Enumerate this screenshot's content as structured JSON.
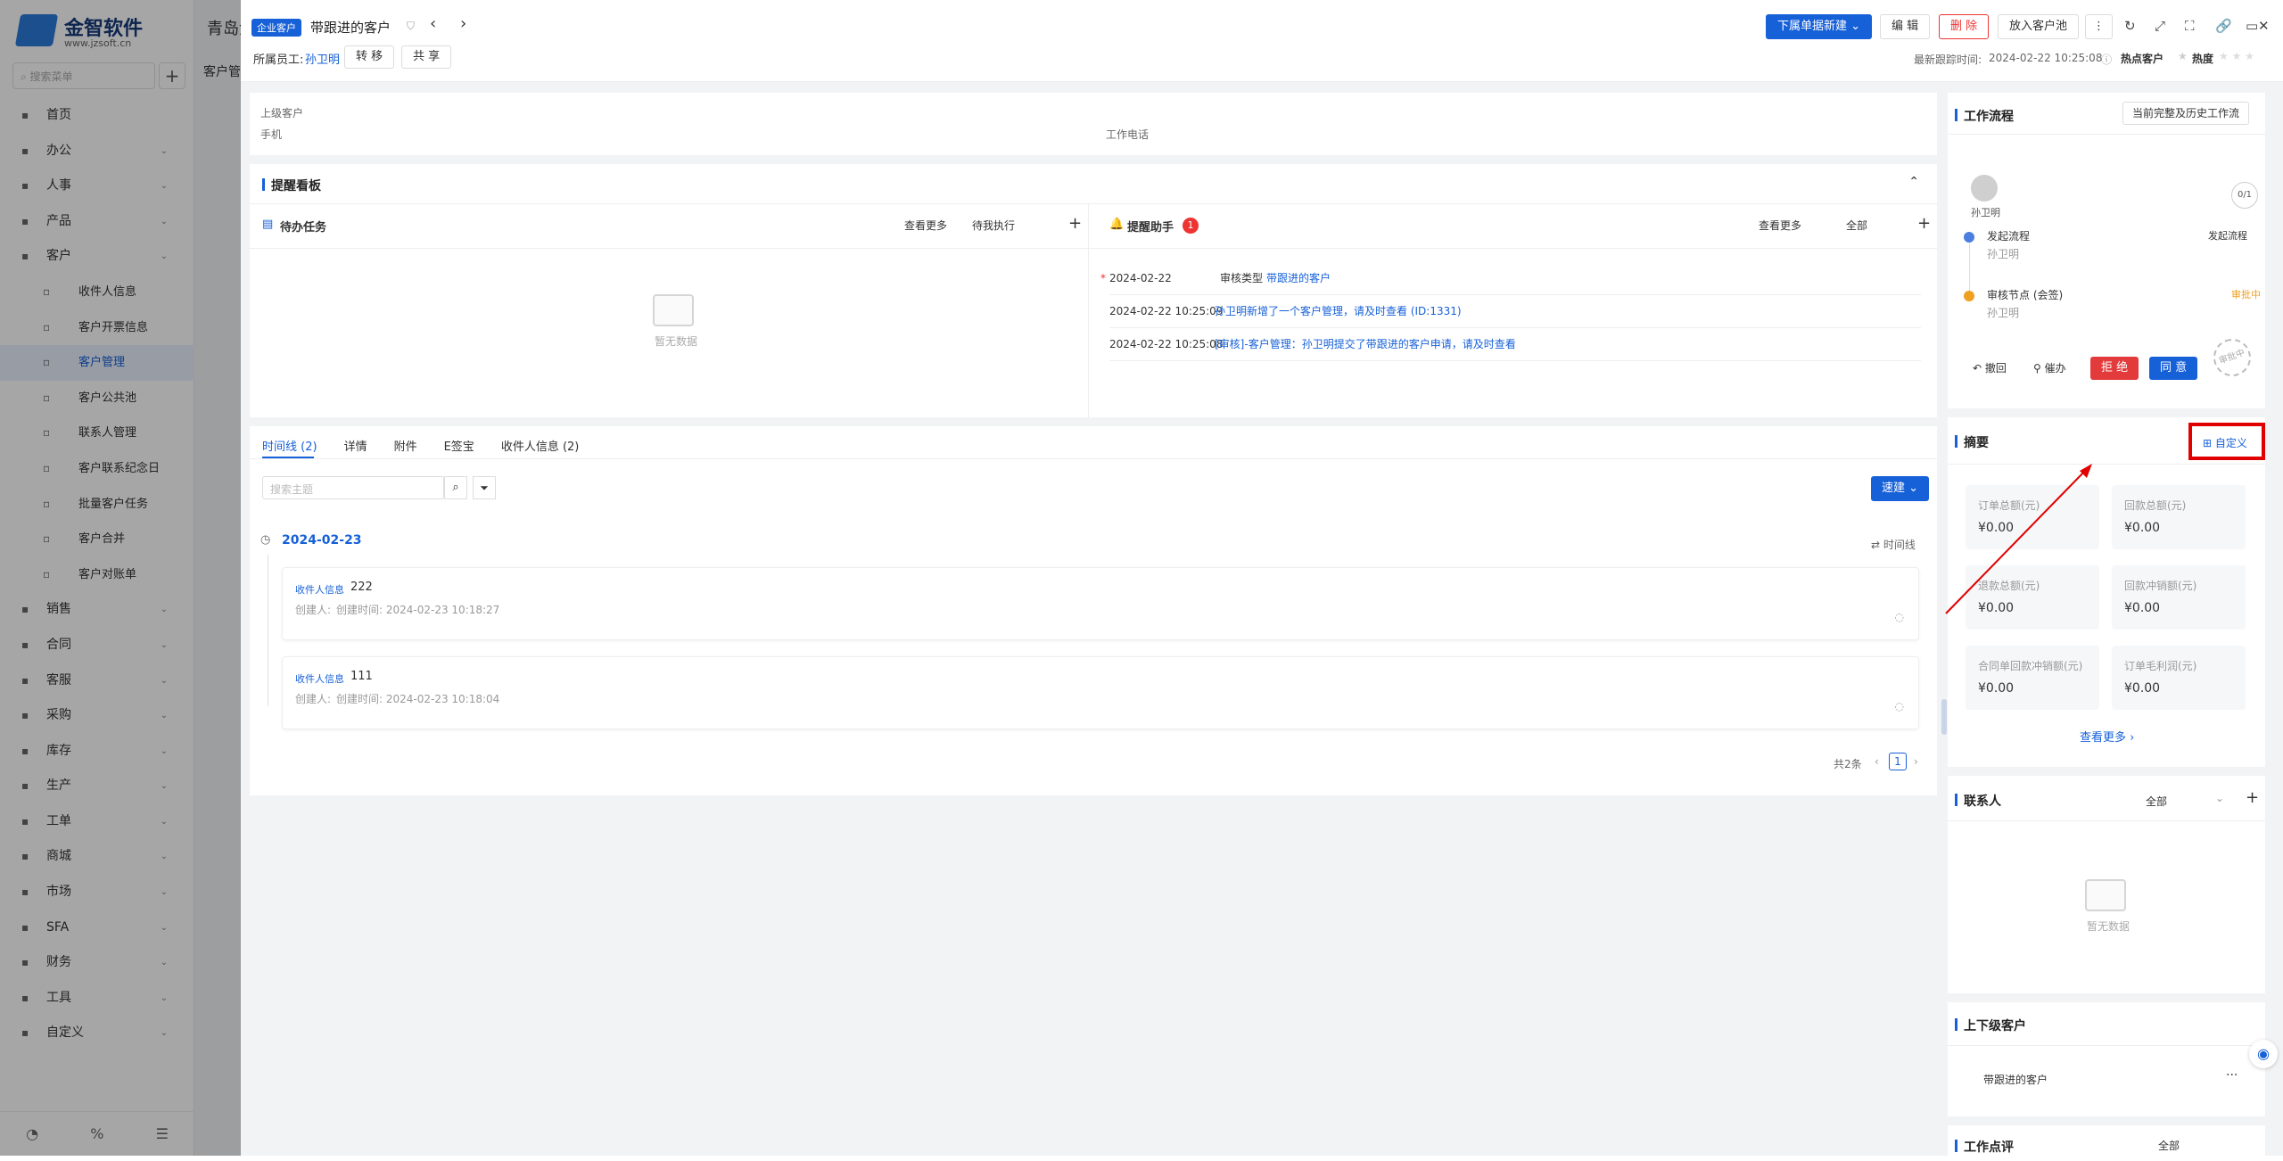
{
  "background_app": {
    "logo_name": "金智软件",
    "logo_url": "www.jzsoft.cn",
    "title": "青岛金",
    "sidebar_search_placeholder": "搜索菜单",
    "section_label": "客户管",
    "nav": [
      {
        "label": "首页",
        "chevron": false,
        "sub": false
      },
      {
        "label": "办公",
        "chevron": true,
        "sub": false
      },
      {
        "label": "人事",
        "chevron": true,
        "sub": false
      },
      {
        "label": "产品",
        "chevron": true,
        "sub": false
      },
      {
        "label": "客户",
        "chevron": true,
        "sub": false
      },
      {
        "label": "收件人信息",
        "chevron": false,
        "sub": true
      },
      {
        "label": "客户开票信息",
        "chevron": false,
        "sub": true
      },
      {
        "label": "客户管理",
        "chevron": false,
        "sub": true,
        "active": true
      },
      {
        "label": "客户公共池",
        "chevron": false,
        "sub": true
      },
      {
        "label": "联系人管理",
        "chevron": false,
        "sub": true
      },
      {
        "label": "客户联系纪念日",
        "chevron": false,
        "sub": true
      },
      {
        "label": "批量客户任务",
        "chevron": false,
        "sub": true
      },
      {
        "label": "客户合并",
        "chevron": false,
        "sub": true
      },
      {
        "label": "客户对账单",
        "chevron": false,
        "sub": true
      },
      {
        "label": "销售",
        "chevron": true,
        "sub": false
      },
      {
        "label": "合同",
        "chevron": true,
        "sub": false
      },
      {
        "label": "客服",
        "chevron": true,
        "sub": false
      },
      {
        "label": "采购",
        "chevron": true,
        "sub": false
      },
      {
        "label": "库存",
        "chevron": true,
        "sub": false
      },
      {
        "label": "生产",
        "chevron": true,
        "sub": false
      },
      {
        "label": "工单",
        "chevron": true,
        "sub": false
      },
      {
        "label": "商城",
        "chevron": true,
        "sub": false
      },
      {
        "label": "市场",
        "chevron": true,
        "sub": false
      },
      {
        "label": "SFA",
        "chevron": true,
        "sub": false
      },
      {
        "label": "财务",
        "chevron": true,
        "sub": false
      },
      {
        "label": "工具",
        "chevron": true,
        "sub": false
      },
      {
        "label": "自定义",
        "chevron": true,
        "sub": false
      }
    ]
  },
  "header": {
    "tag": "企业客户",
    "title": "带跟进的客户",
    "owner_label": "所属员工:",
    "owner_name": "孙卫明",
    "transfer": "转 移",
    "share": "共 享",
    "new_btn": "下属单据新建",
    "edit_btn": "编 辑",
    "delete_btn": "删 除",
    "pool_btn": "放入客户池",
    "last_follow": "最新跟踪时间:",
    "last_follow_time": "2024-02-22 10:25:08",
    "hot_label": "热点客户",
    "heat_label": "热度"
  },
  "info": {
    "parent": "上级客户",
    "phone": "手机",
    "work_phone": "工作电话"
  },
  "reminder": {
    "title": "提醒看板",
    "todo_title": "待办任务",
    "todo_more": "查看更多",
    "todo_filter": "待我执行",
    "empty": "暂无数据",
    "assistant_title": "提醒助手",
    "assistant_badge": "1",
    "assistant_more": "查看更多",
    "assistant_filter": "全部",
    "items": [
      {
        "time": "2024-02-22",
        "prefix": "审核类型",
        "text": "带跟进的客户"
      },
      {
        "time": "2024-02-22 10:25:09",
        "prefix": "",
        "text": "孙卫明新增了一个客户管理，请及时查看 (ID:1331)"
      },
      {
        "time": "2024-02-22 10:25:08",
        "prefix": "",
        "text": "[审核]-客户管理：孙卫明提交了带跟进的客户申请，请及时查看"
      }
    ]
  },
  "timeline": {
    "tabs": [
      "时间线 (2)",
      "详情",
      "附件",
      "E签宝",
      "收件人信息 (2)"
    ],
    "search_placeholder": "搜索主题",
    "quick_new": "速建",
    "date": "2024-02-23",
    "view_label": "时间线",
    "entries": [
      {
        "type": "收件人信息",
        "value": "222",
        "creator": "创建人:",
        "created": "创建时间: 2024-02-23 10:18:27"
      },
      {
        "type": "收件人信息",
        "value": "111",
        "creator": "创建人:",
        "created": "创建时间: 2024-02-23 10:18:04"
      }
    ],
    "total": "共2条",
    "page": "1"
  },
  "workflow": {
    "title": "工作流程",
    "history_btn": "当前完整及历史工作流",
    "user": "孙卫明",
    "count": "0/1",
    "step1": "发起流程",
    "step1_user": "孙卫明",
    "step1_status": "发起流程",
    "step2": "审核节点 (会签)",
    "step2_user": "孙卫明",
    "step2_status": "审批中",
    "revoke": "撤回",
    "urge": "催办",
    "reject": "拒 绝",
    "approve": "同 意",
    "stamp": "审批中"
  },
  "summary": {
    "title": "摘要",
    "customize": "自定义",
    "boxes": [
      {
        "label": "订单总额(元)",
        "value": "¥0.00"
      },
      {
        "label": "回款总额(元)",
        "value": "¥0.00"
      },
      {
        "label": "退款总额(元)",
        "value": "¥0.00"
      },
      {
        "label": "回款冲销额(元)",
        "value": "¥0.00"
      },
      {
        "label": "合同单回款冲销额(元)",
        "value": "¥0.00"
      },
      {
        "label": "订单毛利润(元)",
        "value": "¥0.00"
      }
    ],
    "more": "查看更多"
  },
  "contacts": {
    "title": "联系人",
    "filter": "全部",
    "empty": "暂无数据"
  },
  "hierarchy": {
    "title": "上下级客户",
    "item": "带跟进的客户"
  },
  "bottom_panel": {
    "title": "工作点评",
    "filter": "全部"
  },
  "colors": {
    "accent": "#1660d8",
    "danger": "#e33b3b",
    "highlight": "#e00000"
  }
}
